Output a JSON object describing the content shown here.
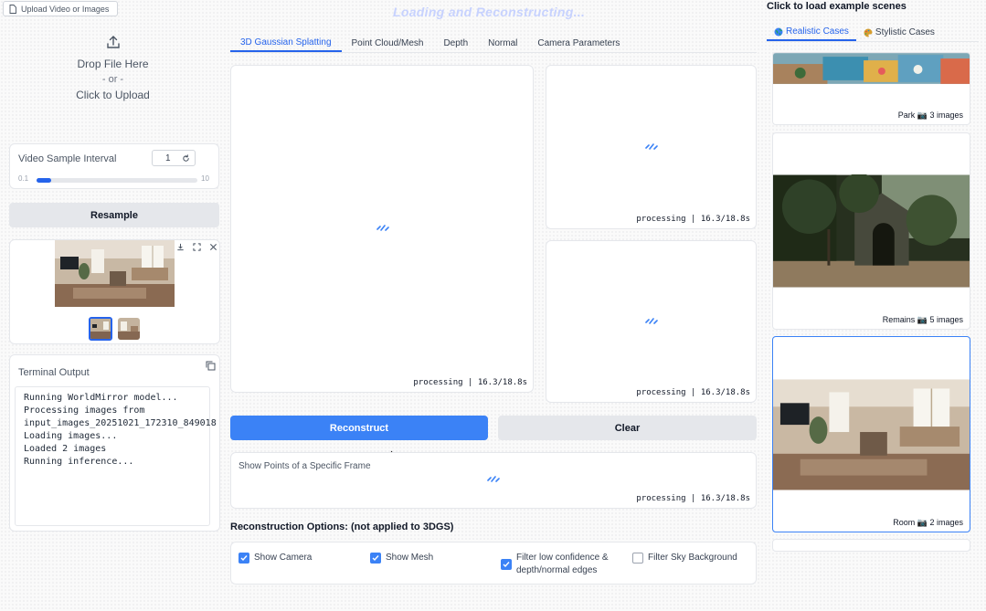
{
  "upload": {
    "tag_label": "Upload Video or Images",
    "drop_text": "Drop File Here",
    "or_text": "- or -",
    "click_text": "Click to Upload"
  },
  "interval": {
    "label": "Video Sample Interval",
    "value": "1",
    "slider_min": "0.1",
    "slider_max": "10",
    "slider_fraction": 0.09
  },
  "resample_label": "Resample",
  "terminal": {
    "label": "Terminal Output",
    "lines": [
      "Running WorldMirror model...",
      "Processing images from",
      "input_images_20251021_172310_849018",
      "Loading images...",
      "Loaded 2 images",
      "Running inference..."
    ]
  },
  "status": {
    "loading": "Loading and Reconstructing...",
    "processing": "processing | 16.3/18.8s"
  },
  "tabs": [
    {
      "label": "3D Gaussian Splatting",
      "active": true
    },
    {
      "label": "Point Cloud/Mesh",
      "active": false
    },
    {
      "label": "Depth",
      "active": false
    },
    {
      "label": "Normal",
      "active": false
    },
    {
      "label": "Camera Parameters",
      "active": false
    }
  ],
  "buttons": {
    "reconstruct": "Reconstruct",
    "clear": "Clear"
  },
  "frame_label": "Show Points of a Specific Frame",
  "options": {
    "heading": "Reconstruction Options: (not applied to 3DGS)",
    "show_camera": "Show Camera",
    "show_mesh": "Show Mesh",
    "filter_low_line1": "Filter low confidence &",
    "filter_low_line2": "depth/normal edges",
    "filter_sky": "Filter Sky Background"
  },
  "examples": {
    "title": "Click to load example scenes",
    "tabs": [
      {
        "label": "Realistic Cases",
        "icon": "globe-icon"
      },
      {
        "label": "Stylistic Cases",
        "icon": "palette-icon"
      }
    ],
    "cards": [
      {
        "caption": "Park 📷 3 images"
      },
      {
        "caption": "Remains 📷 5 images"
      },
      {
        "caption": "Room 📷 2 images"
      }
    ]
  },
  "colors": {
    "accent": "#3b82f6",
    "loading_text": "#c7d2fe"
  }
}
